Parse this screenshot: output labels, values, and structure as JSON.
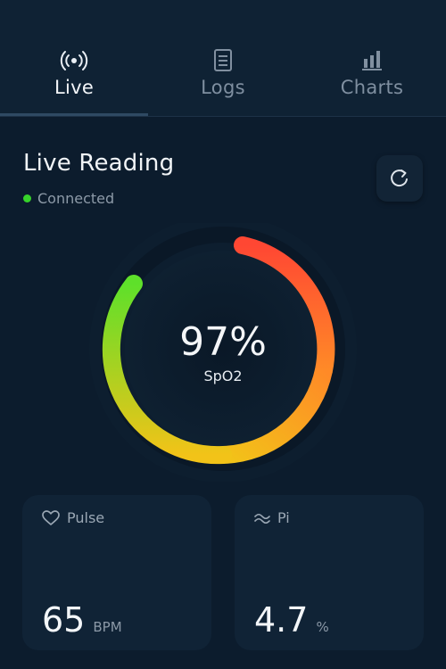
{
  "tabs": [
    {
      "label": "Live",
      "icon": "broadcast-icon",
      "active": true
    },
    {
      "label": "Logs",
      "icon": "document-icon",
      "active": false
    },
    {
      "label": "Charts",
      "icon": "bar-chart-icon",
      "active": false
    }
  ],
  "header": {
    "title": "Live Reading",
    "status": "Connected",
    "status_color": "#36d32a",
    "refresh_icon": "refresh-icon"
  },
  "gauge": {
    "value_text": "97%",
    "label": "SpO2",
    "colors": [
      "#5ee02a",
      "#f2c318",
      "#ff8a27",
      "#ff4733"
    ]
  },
  "cards": {
    "pulse": {
      "label": "Pulse",
      "icon": "heart-icon",
      "value": "65",
      "unit": "BPM"
    },
    "pi": {
      "label": "Pi",
      "icon": "wave-icon",
      "value": "4.7",
      "unit": "%"
    }
  }
}
